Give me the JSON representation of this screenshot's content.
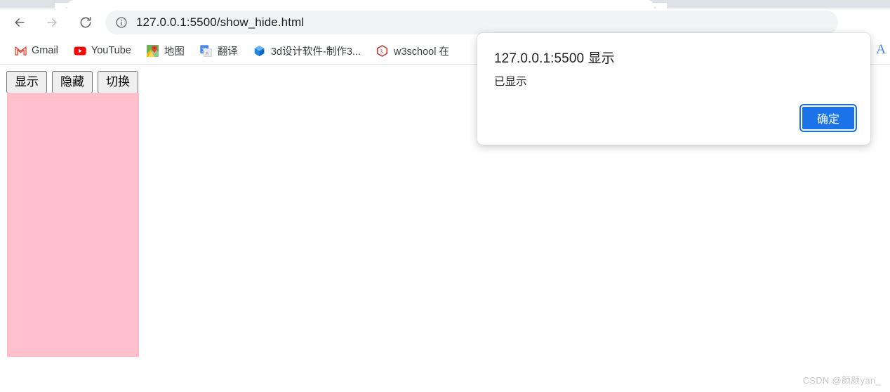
{
  "browser": {
    "nav": {
      "back_label": "Back",
      "forward_label": "Forward",
      "reload_label": "Reload"
    },
    "omnibox": {
      "url": "127.0.0.1:5500/show_hide.html",
      "security_icon": "info-circle-icon"
    },
    "bookmarks": [
      {
        "label": "Gmail",
        "icon": "gmail-icon"
      },
      {
        "label": "YouTube",
        "icon": "youtube-icon"
      },
      {
        "label": "地图",
        "icon": "google-maps-icon"
      },
      {
        "label": "翻译",
        "icon": "google-translate-icon"
      },
      {
        "label": "3d设计软件-制作3...",
        "icon": "3d-software-icon"
      },
      {
        "label": "w3school 在",
        "icon": "w3school-icon"
      }
    ],
    "profile": {
      "letter": "A"
    }
  },
  "page": {
    "buttons": [
      {
        "label": "显示"
      },
      {
        "label": "隐藏"
      },
      {
        "label": "切换"
      }
    ],
    "box": {
      "color": "#ffc0cb"
    },
    "watermark": "CSDN @颜颜yan_"
  },
  "dialog": {
    "title": "127.0.0.1:5500 显示",
    "message": "已显示",
    "ok_label": "确定",
    "accent_color": "#1a73e8"
  }
}
